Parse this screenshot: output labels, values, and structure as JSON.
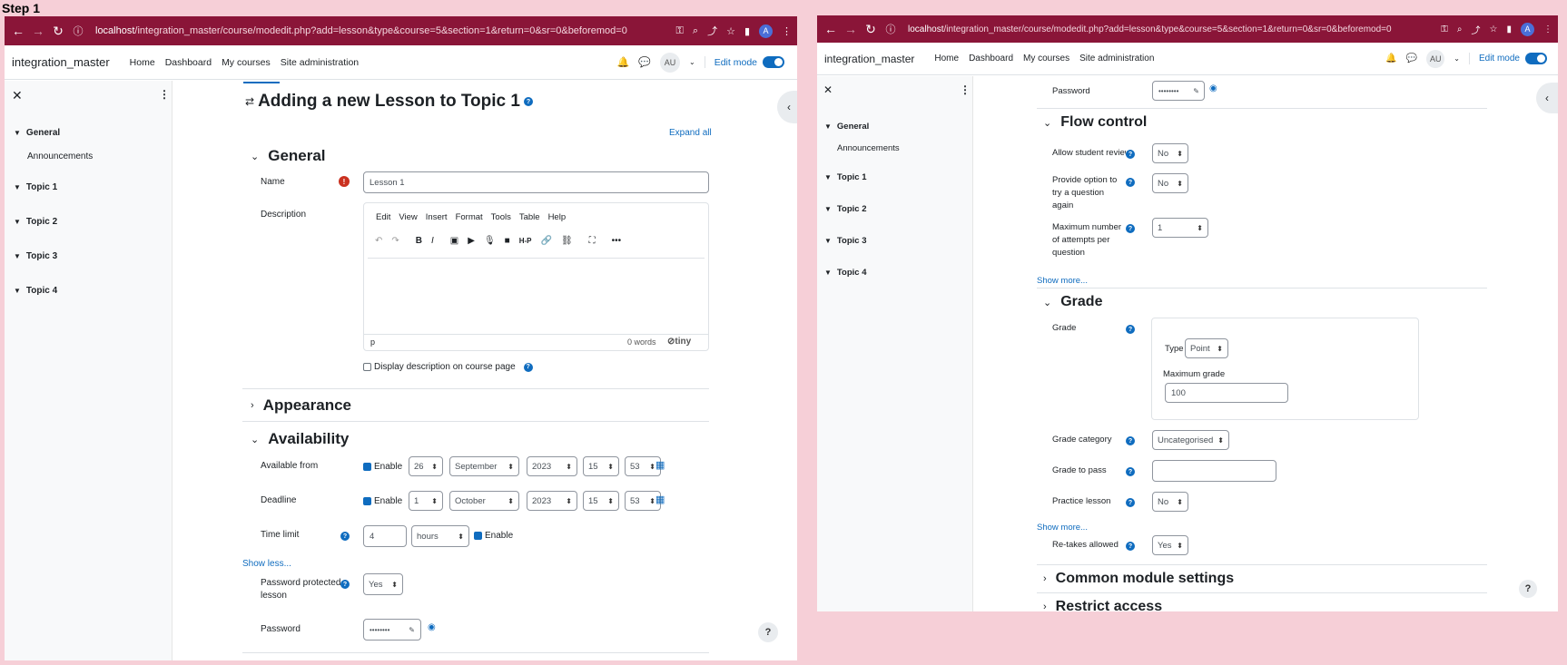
{
  "step_label": "Step 1",
  "browser": {
    "url_host": "localhost",
    "url_path": "/integration_master/course/modedit.php?add=lesson&type&course=5&section=1&return=0&sr=0&beforemod=0",
    "avatar": "A"
  },
  "nav": {
    "brand": "integration_master",
    "links": [
      "Home",
      "Dashboard",
      "My courses",
      "Site administration"
    ],
    "user_initials": "AU",
    "edit_mode": "Edit mode"
  },
  "drawer": {
    "close": "✕",
    "more": "⋮",
    "sections": [
      "General",
      "Topic 1",
      "Topic 2",
      "Topic 3",
      "Topic 4"
    ],
    "general_sub": "Announcements"
  },
  "left": {
    "title": "Adding a new Lesson to Topic 1",
    "expand_all": "Expand all",
    "general_heading": "General",
    "name_label": "Name",
    "name_value": "Lesson 1",
    "description_label": "Description",
    "editor_menu": [
      "Edit",
      "View",
      "Insert",
      "Format",
      "Tools",
      "Table",
      "Help"
    ],
    "editor_path": "p",
    "editor_words": "0 words",
    "editor_brand": "tiny",
    "display_desc": "Display description on course page",
    "appearance_heading": "Appearance",
    "availability_heading": "Availability",
    "available_from_label": "Available from",
    "deadline_label": "Deadline",
    "enable": "Enable",
    "available_from": {
      "day": "26",
      "month": "September",
      "year": "2023",
      "hour": "15",
      "min": "53"
    },
    "deadline": {
      "day": "1",
      "month": "October",
      "year": "2023",
      "hour": "15",
      "min": "53"
    },
    "time_limit_label": "Time limit",
    "time_limit_value": "4",
    "time_limit_unit": "hours",
    "show_less": "Show less...",
    "pw_protected_label": "Password protected lesson",
    "pw_protected_value": "Yes",
    "password_label": "Password",
    "password_value": "••••••••"
  },
  "right": {
    "password_label": "Password",
    "password_value": "••••••••",
    "flow_heading": "Flow control",
    "allow_review_label": "Allow student review",
    "allow_review_value": "No",
    "try_again_label": "Provide option to try a question again",
    "try_again_value": "No",
    "max_attempts_label": "Maximum number of attempts per question",
    "max_attempts_value": "1",
    "show_more_1": "Show more...",
    "grade_heading": "Grade",
    "grade_label": "Grade",
    "type_label": "Type",
    "type_value": "Point",
    "max_grade_label": "Maximum grade",
    "max_grade_value": "100",
    "grade_category_label": "Grade category",
    "grade_category_value": "Uncategorised",
    "grade_to_pass_label": "Grade to pass",
    "grade_to_pass_value": "",
    "practice_label": "Practice lesson",
    "practice_value": "No",
    "show_more_2": "Show more...",
    "retakes_label": "Re-takes allowed",
    "retakes_value": "Yes",
    "common_heading": "Common module settings",
    "restrict_heading": "Restrict access"
  },
  "colors": {
    "chrome": "#8a1538",
    "accent": "#0f6cbf",
    "background": "#f6cfd7"
  }
}
